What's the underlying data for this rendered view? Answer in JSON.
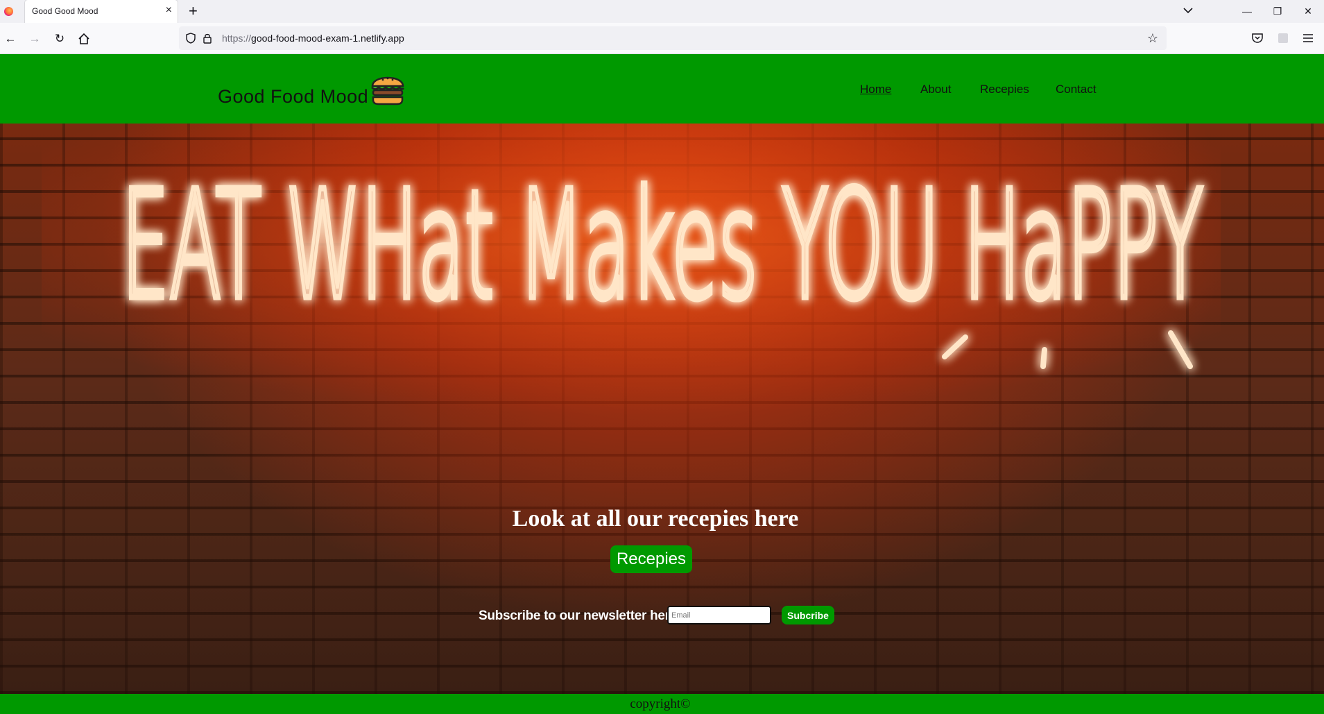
{
  "browser": {
    "tab": {
      "title": "Good Good Mood"
    },
    "url": {
      "protocol": "https://",
      "host": "good-food-mood-exam-1.netlify.app"
    },
    "icons": [
      "back-icon",
      "forward-icon",
      "reload-icon",
      "home-icon",
      "shield-icon",
      "lock-icon",
      "star-icon",
      "pocket-icon",
      "extensions-icon",
      "menu-icon",
      "minimize-icon",
      "restore-icon",
      "close-icon",
      "new-tab-icon",
      "tab-list-icon"
    ]
  },
  "site": {
    "brand": "Good Food Mood",
    "nav": [
      {
        "label": "Home",
        "active": true
      },
      {
        "label": "About",
        "active": false
      },
      {
        "label": "Recepies",
        "active": false
      },
      {
        "label": "Contact",
        "active": false
      }
    ],
    "hero": {
      "neon_sign": "EAT WHat Makes YOU HaPPY",
      "heading": "Look at all our recepies here",
      "button": "Recepies"
    },
    "newsletter": {
      "label": "Subscribe to our newsletter here:",
      "placeholder": "Email",
      "button": "Subcribe"
    },
    "footer": "copyright©",
    "colors": {
      "brand_green": "#009900",
      "neon": "#ffd9b0",
      "neon_glow": "#ff3d00"
    }
  }
}
